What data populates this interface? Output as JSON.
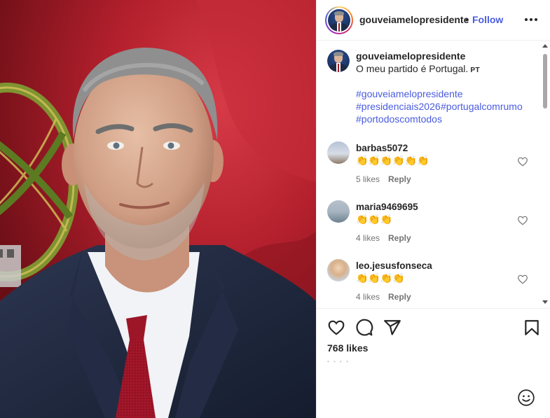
{
  "post": {
    "username": "gouveiamelopresidente",
    "separator": "•",
    "follow_label": "Follow",
    "more_icon": "more-horizontal-icon"
  },
  "caption": {
    "username": "gouveiamelopresidente",
    "text": "O meu partido é Portugal.",
    "lang_badge": "PT",
    "hashtags": [
      "#gouveiamelopresidente",
      "#presidenciais2026",
      "#portugalcomrumo",
      "#portodoscomtodos"
    ]
  },
  "comments": [
    {
      "username": "barbas5072",
      "text": "👏👏👏👏👏👏",
      "likes": "5 likes",
      "reply": "Reply"
    },
    {
      "username": "maria9469695",
      "text": "👏👏👏",
      "likes": "4 likes",
      "reply": "Reply"
    },
    {
      "username": "leo.jesusfonseca",
      "text": "👏👏👏👏",
      "likes": "4 likes",
      "reply": "Reply"
    }
  ],
  "actions": {
    "likes_count": "768 likes",
    "like_icon": "heart-icon",
    "comment_icon": "comment-icon",
    "share_icon": "share-icon",
    "save_icon": "bookmark-icon",
    "emoji_icon": "smiley-icon"
  },
  "colors": {
    "link": "#4a5ce0",
    "flag_red": "#b8222e",
    "flag_green": "#6f8a2e"
  }
}
